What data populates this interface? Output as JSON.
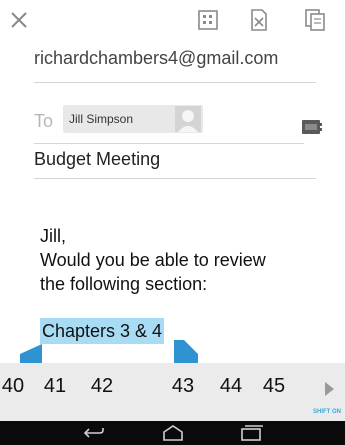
{
  "icons": {
    "close": "close-icon",
    "grid": "grid-select-icon",
    "edit": "edit-icon",
    "copy": "copy-icon",
    "contacts": "contacts-icon",
    "avatar": "person-avatar-icon",
    "arrow": "arrow-right-icon",
    "back": "back-icon",
    "home": "home-icon",
    "recent": "recent-apps-icon"
  },
  "compose": {
    "from": "richardchambers4@gmail.com",
    "to_label": "To",
    "recipient": "Jill Simpson",
    "subject": "Budget Meeting",
    "body_lines": [
      "Jill,",
      "Would you be able to review",
      "the following section:"
    ],
    "selected_text": "Chapters 3 & 4"
  },
  "keyboard": {
    "keys": [
      "40",
      "41",
      "42",
      "43",
      "44",
      "45"
    ],
    "shift_state": "SHIFT ON"
  },
  "colors": {
    "selection": "#a8dcf4",
    "handle": "#2e93d0",
    "shift_on": "#3ba8d8"
  }
}
